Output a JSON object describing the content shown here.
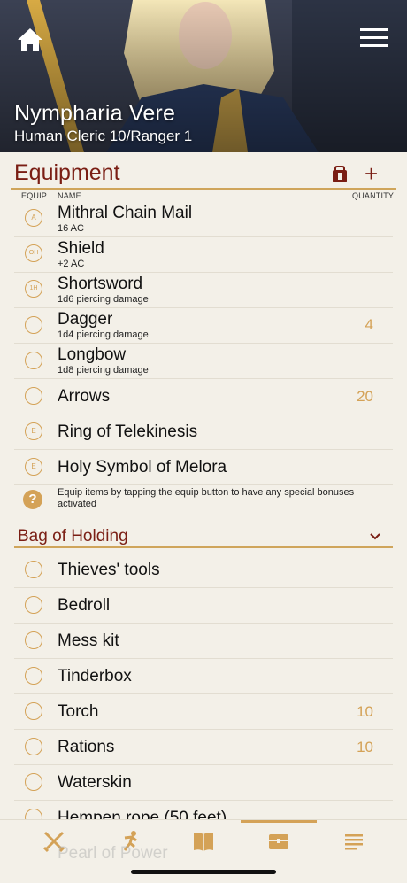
{
  "header": {
    "character_name": "Nympharia Vere",
    "character_class": "Human Cleric 10/Ranger 1"
  },
  "equipment": {
    "title": "Equipment",
    "col_equip": "EQUIP",
    "col_name": "NAME",
    "col_quantity": "QUANTITY",
    "items": [
      {
        "name": "Mithral Chain Mail",
        "sub": "16 AC",
        "equip": "A",
        "qty": ""
      },
      {
        "name": "Shield",
        "sub": "+2 AC",
        "equip": "OH",
        "qty": ""
      },
      {
        "name": "Shortsword",
        "sub": "1d6 piercing damage",
        "equip": "1H",
        "qty": ""
      },
      {
        "name": "Dagger",
        "sub": "1d4 piercing damage",
        "equip": "",
        "qty": "4"
      },
      {
        "name": "Longbow",
        "sub": "1d8 piercing damage",
        "equip": "",
        "qty": ""
      },
      {
        "name": "Arrows",
        "sub": "",
        "equip": "",
        "qty": "20"
      },
      {
        "name": "Ring of Telekinesis",
        "sub": "",
        "equip": "E",
        "qty": ""
      },
      {
        "name": "Holy Symbol of Melora",
        "sub": "",
        "equip": "E",
        "qty": ""
      }
    ],
    "help_text": "Equip items by tapping the equip button to have any special bonuses activated"
  },
  "bag": {
    "title": "Bag of Holding",
    "items": [
      {
        "name": "Thieves' tools",
        "qty": ""
      },
      {
        "name": "Bedroll",
        "qty": ""
      },
      {
        "name": "Mess kit",
        "qty": ""
      },
      {
        "name": "Tinderbox",
        "qty": ""
      },
      {
        "name": "Torch",
        "qty": "10"
      },
      {
        "name": "Rations",
        "qty": "10"
      },
      {
        "name": "Waterskin",
        "qty": ""
      },
      {
        "name": "Hempen rope (50 feet)",
        "qty": ""
      }
    ],
    "ghost_item": "Pearl of Power"
  },
  "colors": {
    "accent": "#d4a257",
    "title": "#7a1e14",
    "background": "#f3f0e8"
  },
  "tabs": [
    {
      "icon": "swords-icon"
    },
    {
      "icon": "running-icon"
    },
    {
      "icon": "spellbook-icon"
    },
    {
      "icon": "chest-icon",
      "active": true
    },
    {
      "icon": "notes-icon"
    }
  ]
}
